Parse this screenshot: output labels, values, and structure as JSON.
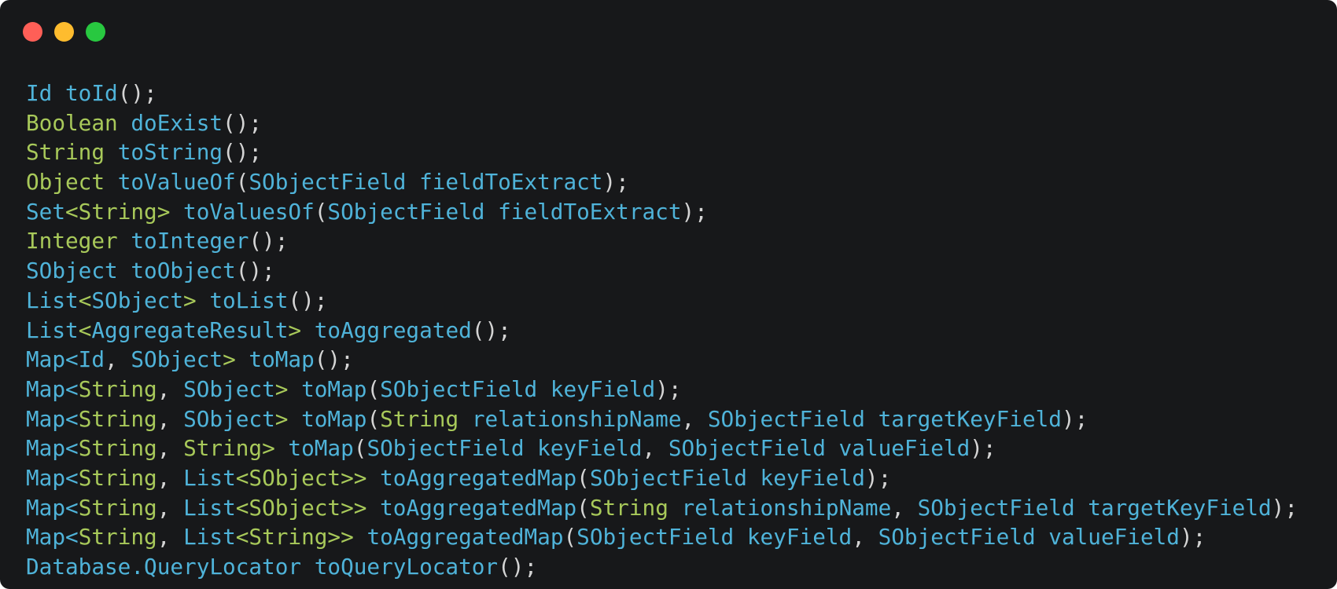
{
  "window": {
    "controls": [
      {
        "name": "close",
        "color": "#ff5f57"
      },
      {
        "name": "minimize",
        "color": "#febc2e"
      },
      {
        "name": "maximize",
        "color": "#28c840"
      }
    ],
    "background": "#17181a"
  },
  "colors": {
    "t": "#4fb3d9",
    "g": "#a8c95a",
    "p": "#d4d4d4"
  },
  "code_lines": [
    [
      [
        "Id toId",
        "t"
      ],
      [
        "();",
        "p"
      ]
    ],
    [
      [
        "Boolean ",
        "g"
      ],
      [
        "doExist",
        "t"
      ],
      [
        "();",
        "p"
      ]
    ],
    [
      [
        "String ",
        "g"
      ],
      [
        "toString",
        "t"
      ],
      [
        "();",
        "p"
      ]
    ],
    [
      [
        "Object ",
        "g"
      ],
      [
        "toValueOf",
        "t"
      ],
      [
        "(",
        "p"
      ],
      [
        "SObjectField fieldToExtract",
        "t"
      ],
      [
        ");",
        "p"
      ]
    ],
    [
      [
        "Set",
        "t"
      ],
      [
        "<String> ",
        "g"
      ],
      [
        "toValuesOf",
        "t"
      ],
      [
        "(",
        "p"
      ],
      [
        "SObjectField fieldToExtract",
        "t"
      ],
      [
        ");",
        "p"
      ]
    ],
    [
      [
        "Integer ",
        "g"
      ],
      [
        "toInteger",
        "t"
      ],
      [
        "();",
        "p"
      ]
    ],
    [
      [
        "SObject toObject",
        "t"
      ],
      [
        "();",
        "p"
      ]
    ],
    [
      [
        "List",
        "t"
      ],
      [
        "<",
        "g"
      ],
      [
        "SObject",
        "t"
      ],
      [
        "> ",
        "g"
      ],
      [
        "toList",
        "t"
      ],
      [
        "();",
        "p"
      ]
    ],
    [
      [
        "List",
        "t"
      ],
      [
        "<",
        "g"
      ],
      [
        "AggregateResult",
        "t"
      ],
      [
        "> ",
        "g"
      ],
      [
        "toAggregated",
        "t"
      ],
      [
        "();",
        "p"
      ]
    ],
    [
      [
        "Map<Id",
        "t"
      ],
      [
        ", ",
        "p"
      ],
      [
        "SObject",
        "t"
      ],
      [
        "> ",
        "g"
      ],
      [
        "toMap",
        "t"
      ],
      [
        "();",
        "p"
      ]
    ],
    [
      [
        "Map<",
        "t"
      ],
      [
        "String",
        "g"
      ],
      [
        ", ",
        "p"
      ],
      [
        "SObject",
        "t"
      ],
      [
        "> ",
        "g"
      ],
      [
        "toMap",
        "t"
      ],
      [
        "(",
        "p"
      ],
      [
        "SObjectField keyField",
        "t"
      ],
      [
        ");",
        "p"
      ]
    ],
    [
      [
        "Map<",
        "t"
      ],
      [
        "String",
        "g"
      ],
      [
        ", ",
        "p"
      ],
      [
        "SObject",
        "t"
      ],
      [
        "> ",
        "g"
      ],
      [
        "toMap",
        "t"
      ],
      [
        "(",
        "p"
      ],
      [
        "String ",
        "g"
      ],
      [
        "relationshipName",
        "t"
      ],
      [
        ", ",
        "p"
      ],
      [
        "SObjectField targetKeyField",
        "t"
      ],
      [
        ");",
        "p"
      ]
    ],
    [
      [
        "Map<",
        "t"
      ],
      [
        "String",
        "g"
      ],
      [
        ", ",
        "p"
      ],
      [
        "String> ",
        "g"
      ],
      [
        "toMap",
        "t"
      ],
      [
        "(",
        "p"
      ],
      [
        "SObjectField keyField",
        "t"
      ],
      [
        ", ",
        "p"
      ],
      [
        "SObjectField valueField",
        "t"
      ],
      [
        ");",
        "p"
      ]
    ],
    [
      [
        "Map<",
        "t"
      ],
      [
        "String",
        "g"
      ],
      [
        ", ",
        "p"
      ],
      [
        "List",
        "t"
      ],
      [
        "<SObject>> ",
        "g"
      ],
      [
        "toAggregatedMap",
        "t"
      ],
      [
        "(",
        "p"
      ],
      [
        "SObjectField keyField",
        "t"
      ],
      [
        ");",
        "p"
      ]
    ],
    [
      [
        "Map<",
        "t"
      ],
      [
        "String",
        "g"
      ],
      [
        ", ",
        "p"
      ],
      [
        "List",
        "t"
      ],
      [
        "<SObject>> ",
        "g"
      ],
      [
        "toAggregatedMap",
        "t"
      ],
      [
        "(",
        "p"
      ],
      [
        "String ",
        "g"
      ],
      [
        "relationshipName",
        "t"
      ],
      [
        ", ",
        "p"
      ],
      [
        "SObjectField targetKeyField",
        "t"
      ],
      [
        ");",
        "p"
      ]
    ],
    [
      [
        "Map<",
        "t"
      ],
      [
        "String",
        "g"
      ],
      [
        ", ",
        "p"
      ],
      [
        "List",
        "t"
      ],
      [
        "<String>> ",
        "g"
      ],
      [
        "toAggregatedMap",
        "t"
      ],
      [
        "(",
        "p"
      ],
      [
        "SObjectField keyField",
        "t"
      ],
      [
        ", ",
        "p"
      ],
      [
        "SObjectField valueField",
        "t"
      ],
      [
        ");",
        "p"
      ]
    ],
    [
      [
        "Database.QueryLocator toQueryLocator",
        "t"
      ],
      [
        "();",
        "p"
      ]
    ]
  ]
}
